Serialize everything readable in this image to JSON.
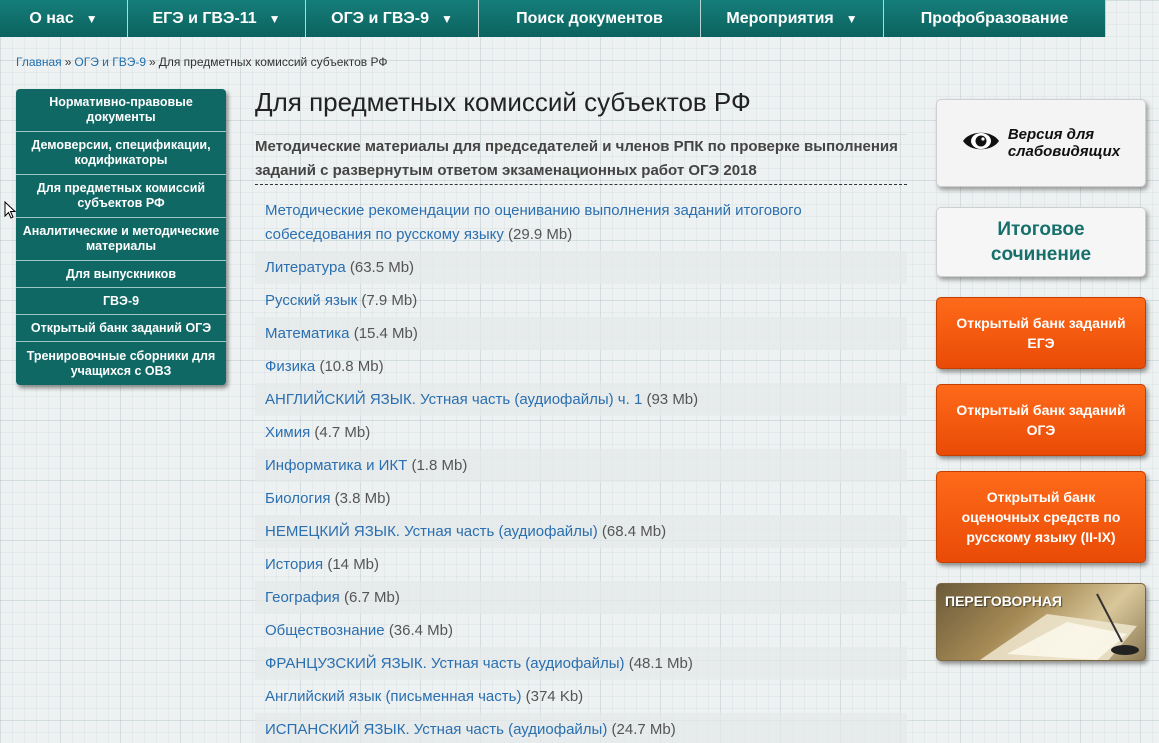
{
  "topnav": [
    {
      "label": "О нас",
      "has_dropdown": true
    },
    {
      "label": "ЕГЭ и ГВЭ-11",
      "has_dropdown": true
    },
    {
      "label": "ОГЭ и ГВЭ-9",
      "has_dropdown": true
    },
    {
      "label": "Поиск документов",
      "has_dropdown": false
    },
    {
      "label": "Мероприятия",
      "has_dropdown": true
    },
    {
      "label": "Профобразование",
      "has_dropdown": false
    }
  ],
  "breadcrumb": {
    "home": "Главная",
    "section": "ОГЭ и ГВЭ-9",
    "current": "Для предметных комиссий субъектов РФ",
    "separator": "»"
  },
  "leftmenu": [
    "Нормативно-правовые документы",
    "Демоверсии, спецификации, кодификаторы",
    "Для предметных комиссий субъектов РФ",
    "Аналитические и методические материалы",
    "Для выпускников",
    "ГВЭ-9",
    "Открытый банк заданий ОГЭ",
    "Тренировочные сборники для учащихся с ОВЗ"
  ],
  "main": {
    "title": "Для предметных комиссий субъектов РФ",
    "subhead": "Методические материалы для председателей и членов РПК по проверке выполнения заданий с развернутым ответом экзаменационных работ ОГЭ 2018",
    "documents": [
      {
        "title": "Методические рекомендации по оцениванию выполнения заданий итогового собеседования по русскому языку",
        "size": "(29.9 Mb)"
      },
      {
        "title": "Литература",
        "size": "(63.5 Mb)"
      },
      {
        "title": "Русский язык",
        "size": "(7.9 Mb)"
      },
      {
        "title": "Математика",
        "size": "(15.4 Mb)"
      },
      {
        "title": "Физика",
        "size": "(10.8 Mb)"
      },
      {
        "title": "АНГЛИЙСКИЙ ЯЗЫК. Устная часть (аудиофайлы) ч. 1",
        "size": "(93 Mb)"
      },
      {
        "title": "Химия",
        "size": "(4.7 Mb)"
      },
      {
        "title": "Информатика и ИКТ",
        "size": "(1.8 Mb)"
      },
      {
        "title": "Биология",
        "size": "(3.8 Mb)"
      },
      {
        "title": "НЕМЕЦКИЙ ЯЗЫК. Устная часть (аудиофайлы)",
        "size": "(68.4 Mb)"
      },
      {
        "title": "История",
        "size": "(14 Mb)"
      },
      {
        "title": "География",
        "size": "(6.7 Mb)"
      },
      {
        "title": "Обществознание",
        "size": "(36.4 Mb)"
      },
      {
        "title": "ФРАНЦУЗСКИЙ ЯЗЫК. Устная часть (аудиофайлы)",
        "size": "(48.1 Mb)"
      },
      {
        "title": "Английский язык (письменная часть)",
        "size": "(374 Kb)"
      },
      {
        "title": "ИСПАНСКИЙ ЯЗЫК. Устная часть (аудиофайлы)",
        "size": "(24.7 Mb)"
      }
    ]
  },
  "right": {
    "vision_line1": "Версия для",
    "vision_line2": "слабовидящих",
    "essay_line1": "Итоговое",
    "essay_line2": "сочинение",
    "bank_ege": "Открытый банк заданий ЕГЭ",
    "bank_oge": "Открытый банк заданий ОГЭ",
    "bank_russian": "Открытый банк оценочных средств по русскому языку (II-IX)",
    "negotiation": "ПЕРЕГОВОРНАЯ"
  },
  "colors": {
    "nav_teal": "#0f6864",
    "link_blue": "#2a6fb0",
    "orange": "#ff6a1a",
    "essay_teal": "#17706b"
  }
}
